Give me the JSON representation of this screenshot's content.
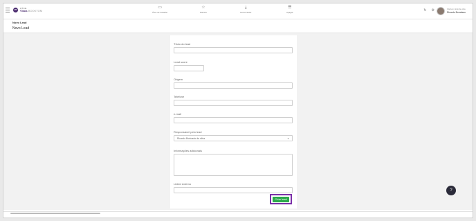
{
  "header": {
    "logo_top": "ATCE",
    "logo_brand": "Visus",
    "logo_suffix": "BOOKTOM",
    "logo_mark": "VP",
    "nav": [
      {
        "icon": "▭",
        "icon_name": "monitor-icon",
        "label": "Área de trabalho"
      },
      {
        "icon": "☆",
        "icon_name": "star-icon",
        "label": "Painéis"
      },
      {
        "icon": "⤓",
        "icon_name": "download-icon",
        "label": "Gerenciador"
      },
      {
        "icon": "☰",
        "icon_name": "list-icon",
        "label": "Apagar"
      }
    ],
    "right_icons": [
      {
        "icon": "↻",
        "icon_name": "refresh-icon"
      },
      {
        "icon": "⚙",
        "icon_name": "gear-icon"
      }
    ],
    "user_hello": "Ola bem vindo de volta",
    "user_name": "Ricardo Bomdasu"
  },
  "breadcrumb": "Novo Lead",
  "page_title": "Novo Lead",
  "form": {
    "fields": {
      "titulo": {
        "label": "Título do lead",
        "value": ""
      },
      "score": {
        "label": "Lead score",
        "value": ""
      },
      "origem": {
        "label": "Origem",
        "value": ""
      },
      "telefone": {
        "label": "Telefone",
        "value": ""
      },
      "email": {
        "label": "e-mail",
        "value": ""
      },
      "responsavel": {
        "label": "Responsável pelo lead",
        "value": "Ricardo Bortoado da silva"
      },
      "informacoes": {
        "label": "Informações adicionais",
        "value": ""
      },
      "linkid": {
        "label": "LinkId externo",
        "value": ""
      }
    },
    "submit_label": "Criar lead"
  },
  "help_icon": "?",
  "colors": {
    "brand": "#4a2a6e",
    "submit": "#2aa84a",
    "highlight": "#7b2fa8"
  }
}
